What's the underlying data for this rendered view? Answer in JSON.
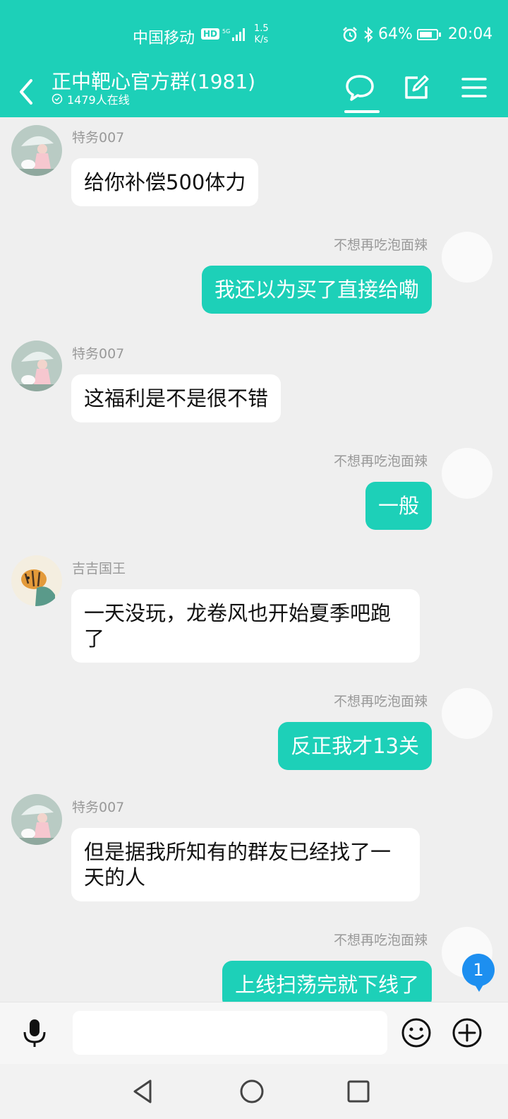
{
  "status_bar": {
    "carrier": "中国移动",
    "hd": "HD",
    "network": "5G",
    "speed_value": "1.5",
    "speed_unit": "K/s",
    "battery": "64%",
    "time": "20:04"
  },
  "header": {
    "title": "正中靶心官方群(1981)",
    "online": "1479人在线"
  },
  "messages": [
    {
      "sender": "特务007",
      "text": "给你补偿500体力",
      "direction": "in"
    },
    {
      "sender": "不想再吃泡面辣",
      "text": "我还以为买了直接给嘞",
      "direction": "out"
    },
    {
      "sender": "特务007",
      "text": "这福利是不是很不错",
      "direction": "in"
    },
    {
      "sender": "不想再吃泡面辣",
      "text": "一般",
      "direction": "out"
    },
    {
      "sender": "吉吉国王",
      "text": "一天没玩，龙卷风也开始夏季吧跑了",
      "direction": "in"
    },
    {
      "sender": "不想再吃泡面辣",
      "text": "反正我才13关",
      "direction": "out"
    },
    {
      "sender": "特务007",
      "text": "但是据我所知有的群友已经找了一天的人",
      "direction": "in"
    },
    {
      "sender": "不想再吃泡面辣",
      "text": "上线扫荡完就下线了",
      "direction": "out"
    }
  ],
  "unread_badge": "1",
  "colors": {
    "accent": "#1dd0b8",
    "badge": "#1d8ff0"
  },
  "icons": [
    "back-arrow-icon",
    "chat-bubble-icon",
    "edit-icon",
    "menu-icon",
    "microphone-icon",
    "emoji-icon",
    "plus-icon",
    "nav-back-icon",
    "nav-home-icon",
    "nav-recents-icon"
  ]
}
